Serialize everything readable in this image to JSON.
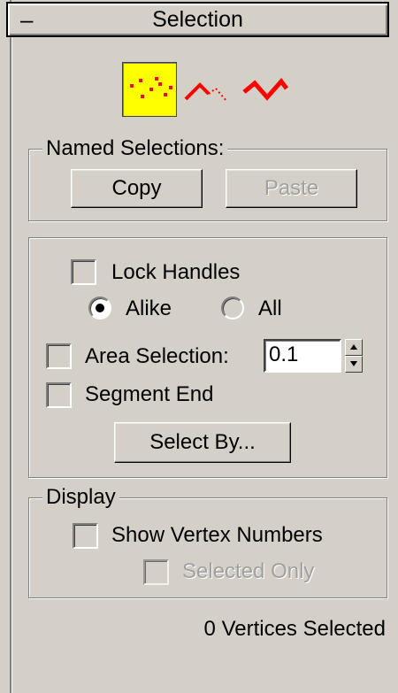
{
  "rollout": {
    "collapse_symbol": "–",
    "title": "Selection"
  },
  "modes": [
    {
      "name": "vertex",
      "icon": "vertex-mode-icon",
      "active": true
    },
    {
      "name": "segment",
      "icon": "segment-mode-icon",
      "active": false
    },
    {
      "name": "spline",
      "icon": "spline-mode-icon",
      "active": false
    }
  ],
  "named_selections": {
    "label": "Named Selections:",
    "copy_label": "Copy",
    "paste_label": "Paste"
  },
  "options": {
    "lock_handles_label": "Lock Handles",
    "alike_label": "Alike",
    "all_label": "All",
    "area_selection_label": "Area Selection:",
    "area_selection_value": "0.1",
    "segment_end_label": "Segment End",
    "select_by_label": "Select By..."
  },
  "display": {
    "label": "Display",
    "show_vertex_numbers_label": "Show Vertex Numbers",
    "selected_only_label": "Selected Only"
  },
  "status": {
    "text": "0 Vertices Selected"
  },
  "colors": {
    "panel": "#d4d0c8",
    "active_mode": "#ffff00",
    "icon_red": "#ff0000"
  }
}
